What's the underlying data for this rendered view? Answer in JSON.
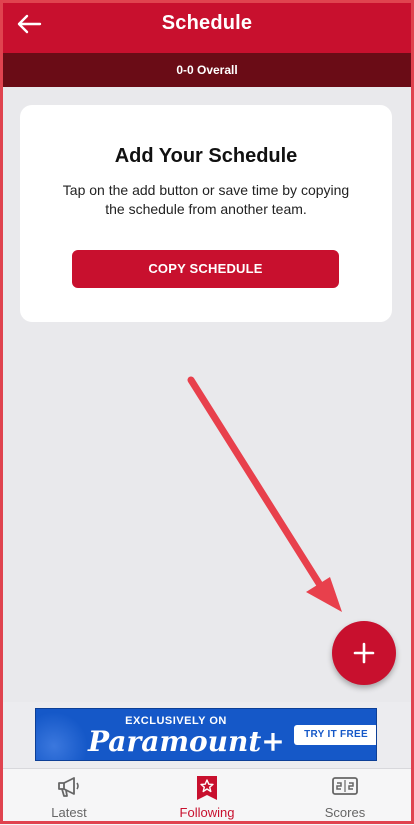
{
  "header": {
    "title": "Schedule",
    "back_icon": "arrow-left-icon",
    "background": "#c8102e"
  },
  "record": {
    "text": "0-0 Overall",
    "background": "#6a0c16"
  },
  "empty_state": {
    "title": "Add Your Schedule",
    "description": "Tap on the add button or save time by copying the schedule from another team.",
    "copy_button_label": "COPY SCHEDULE"
  },
  "fab": {
    "icon": "plus-icon",
    "color": "#c8102e"
  },
  "annotation": {
    "icon": "red-arrow-pointer",
    "color": "#e8404c"
  },
  "ad": {
    "tagline": "EXCLUSIVELY ON",
    "brand": "Paramount+",
    "cta": "TRY IT FREE",
    "background": "#1558c8"
  },
  "tabbar": {
    "tabs": [
      {
        "label": "Latest",
        "icon": "megaphone-icon",
        "active": false
      },
      {
        "label": "Following",
        "icon": "star-badge-icon",
        "active": true
      },
      {
        "label": "Scores",
        "icon": "scoreboard-icon",
        "active": false
      }
    ],
    "active_color": "#c8102e"
  }
}
